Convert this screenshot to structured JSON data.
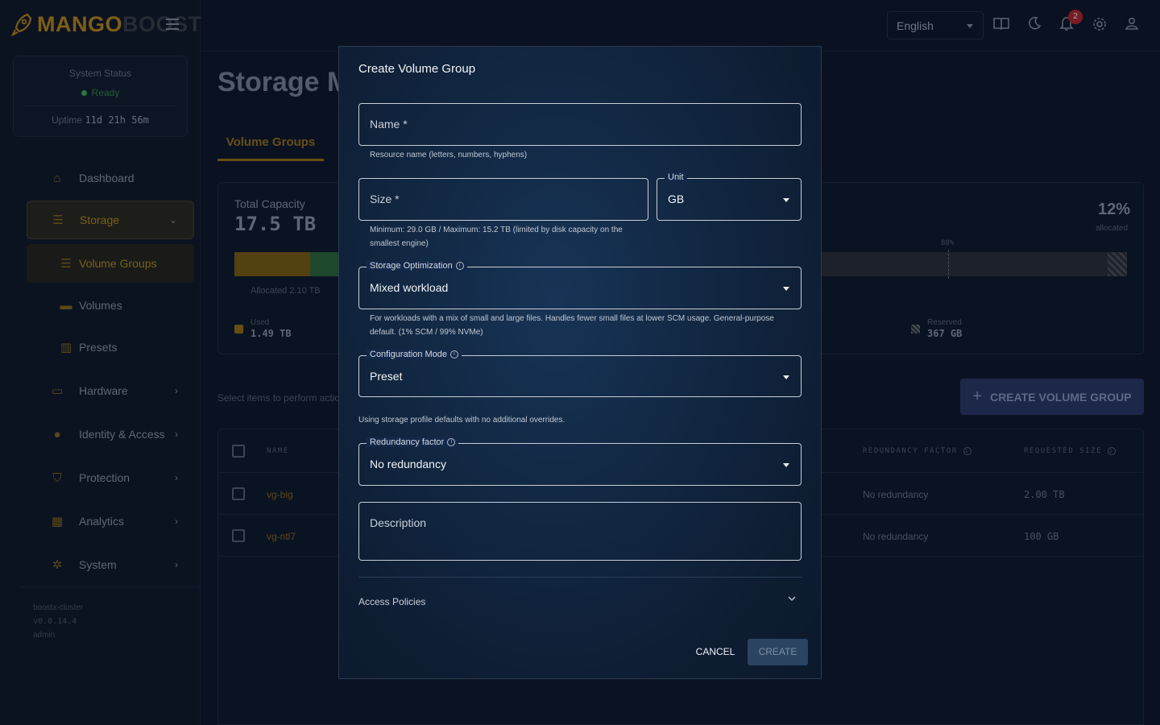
{
  "app": {
    "logo_part1": "MANGO",
    "logo_part2": "BOOST"
  },
  "status": {
    "title": "System Status",
    "state": "Ready",
    "uptime_label": "Uptime",
    "uptime_value": "11d 21h 56m"
  },
  "sidebar": {
    "items": [
      {
        "label": "Dashboard",
        "icon": "home-icon"
      },
      {
        "label": "Storage",
        "icon": "list-icon"
      },
      {
        "label": "Volume Groups",
        "icon": "list-icon"
      },
      {
        "label": "Volumes",
        "icon": "folder-icon"
      },
      {
        "label": "Presets",
        "icon": "chart-icon"
      },
      {
        "label": "Hardware",
        "icon": "laptop-icon"
      },
      {
        "label": "Identity & Access",
        "icon": "person-icon"
      },
      {
        "label": "Protection",
        "icon": "shield-icon"
      },
      {
        "label": "Analytics",
        "icon": "analytics-icon"
      },
      {
        "label": "System",
        "icon": "gear-icon"
      }
    ],
    "footer": {
      "cluster": "boostx-cluster",
      "version": "v0.0.14.4",
      "user": "admin"
    }
  },
  "topbar": {
    "language": "English",
    "notification_count": "2"
  },
  "page": {
    "title": "Storage M",
    "tab": "Volume Groups",
    "capacity": {
      "title": "Total Capacity",
      "value": "17.5 TB",
      "percent": "12%",
      "percent_label": "allocated",
      "threshold_label": "80%",
      "allocated": "Allocated 2.10 TB",
      "used_label": "Used",
      "used_value": "1.49 TB",
      "reserved_label": "Reserved",
      "reserved_value": "367 GB"
    },
    "select_hint": "Select items to perform actio",
    "create_button": "CREATE VOLUME GROUP",
    "table": {
      "headers": {
        "name": "NAME",
        "redundancy": "REDUNDANCY FACTOR",
        "size": "REQUESTED SIZE"
      },
      "rows": [
        {
          "name": "vg-big",
          "redundancy": "No redundancy",
          "size": "2.00 TB"
        },
        {
          "name": "vg-ntl7",
          "redundancy": "No redundancy",
          "size": "100 GB"
        }
      ]
    }
  },
  "modal": {
    "title": "Create Volume Group",
    "name_placeholder": "Name *",
    "name_help": "Resource name (letters, numbers, hyphens)",
    "size_placeholder": "Size *",
    "unit_label": "Unit",
    "unit_value": "GB",
    "size_help_line1": "Minimum: 29.0 GB / Maximum: 15.2 TB (limited by disk capacity on the",
    "size_help_line2": "smallest engine)",
    "storage_opt_label": "Storage Optimization",
    "storage_opt_value": "Mixed workload",
    "storage_opt_help_line1": "For workloads with a mix of small and large files. Handles fewer small files at lower SCM usage. General-purpose",
    "storage_opt_help_line2": "default. (1% SCM / 99% NVMe)",
    "config_label": "Configuration Mode",
    "config_value": "Preset",
    "config_help": "Using storage profile defaults with no additional overrides.",
    "redundancy_label": "Redundancy factor",
    "redundancy_value": "No redundancy",
    "description_placeholder": "Description",
    "access_policies": "Access Policies",
    "cancel": "CANCEL",
    "create": "CREATE"
  }
}
